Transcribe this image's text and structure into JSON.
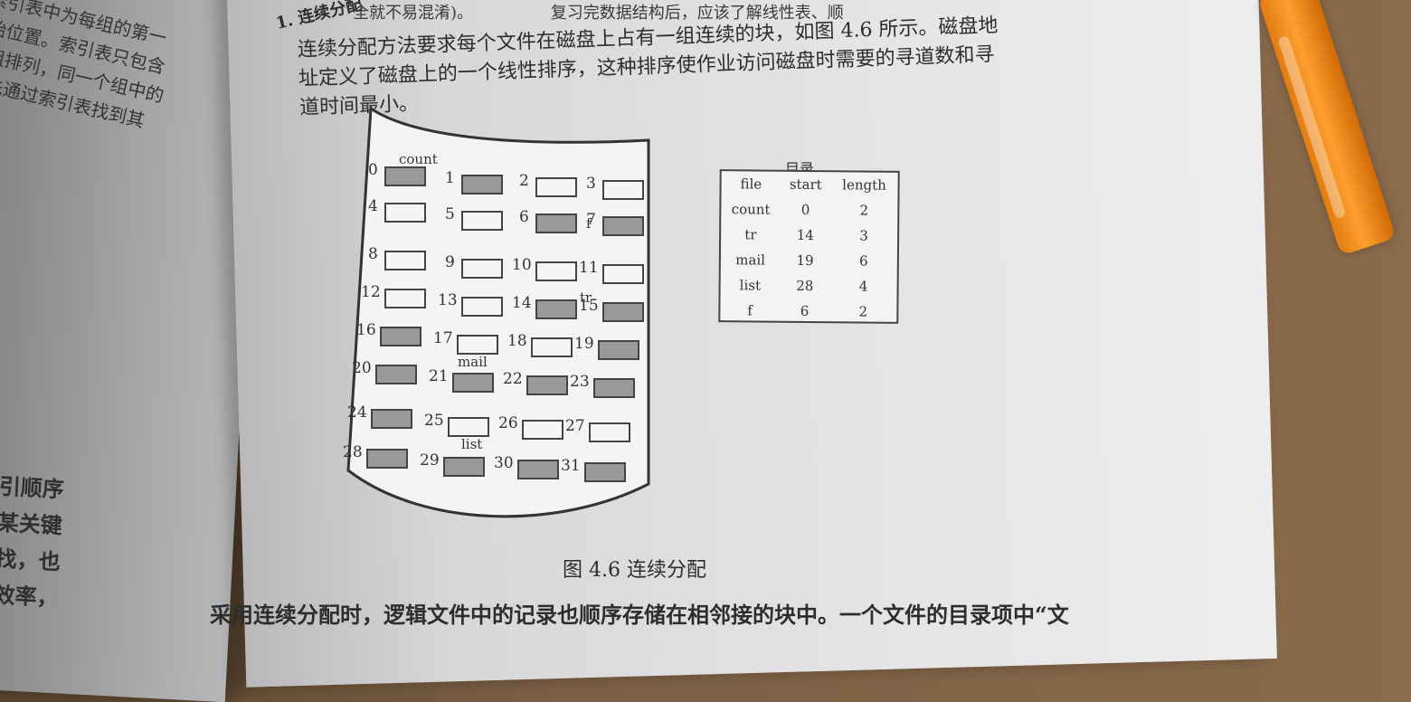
{
  "left_page": {
    "lines": [
      "索引表中为每组的第一",
      "始位置。索引表只包含",
      "组排列，同一个组中的",
      "先通过索引表找到其"
    ],
    "bottom_lines": [
      "在索引顺序",
      "查找某关键",
      "序查找，也",
      "查找效率，"
    ]
  },
  "right_page": {
    "top_text": "全就不易混淆)。",
    "top_text_right": "复习完数据结构后，应该了解线性表、顺",
    "section_title": "1. 连续分配",
    "paragraph": "连续分配方法要求每个文件在磁盘上占有一组连续的块，如图 4.6 所示。磁盘地址定义了磁盘上的一个线性排序，这种排序使作业访问磁盘时需要的寻道数和寻道时间最小。",
    "figure_caption": "图 4.6   连续分配",
    "bottom_text": "采用连续分配时，逻辑文件中的记录也顺序存储在相邻接的块中。一个文件的目录项中“文"
  },
  "figure": {
    "file_labels": [
      "count",
      "f",
      "tr",
      "mail",
      "list"
    ],
    "blocks": [
      {
        "n": "0",
        "fill": true
      },
      {
        "n": "1",
        "fill": true
      },
      {
        "n": "2",
        "fill": false
      },
      {
        "n": "3",
        "fill": false
      },
      {
        "n": "4",
        "fill": false
      },
      {
        "n": "5",
        "fill": false
      },
      {
        "n": "6",
        "fill": true
      },
      {
        "n": "7",
        "fill": true
      },
      {
        "n": "8",
        "fill": false
      },
      {
        "n": "9",
        "fill": false
      },
      {
        "n": "10",
        "fill": false
      },
      {
        "n": "11",
        "fill": false
      },
      {
        "n": "12",
        "fill": false
      },
      {
        "n": "13",
        "fill": false
      },
      {
        "n": "14",
        "fill": true
      },
      {
        "n": "15",
        "fill": true
      },
      {
        "n": "16",
        "fill": true
      },
      {
        "n": "17",
        "fill": false
      },
      {
        "n": "18",
        "fill": false
      },
      {
        "n": "19",
        "fill": true
      },
      {
        "n": "20",
        "fill": true
      },
      {
        "n": "21",
        "fill": true
      },
      {
        "n": "22",
        "fill": true
      },
      {
        "n": "23",
        "fill": true
      },
      {
        "n": "24",
        "fill": true
      },
      {
        "n": "25",
        "fill": false
      },
      {
        "n": "26",
        "fill": false
      },
      {
        "n": "27",
        "fill": false
      },
      {
        "n": "28",
        "fill": true
      },
      {
        "n": "29",
        "fill": true
      },
      {
        "n": "30",
        "fill": true
      },
      {
        "n": "31",
        "fill": true
      }
    ]
  },
  "directory": {
    "title": "目录",
    "headers": [
      "file",
      "start",
      "length"
    ],
    "rows": [
      [
        "count",
        "0",
        "2"
      ],
      [
        "tr",
        "14",
        "3"
      ],
      [
        "mail",
        "19",
        "6"
      ],
      [
        "list",
        "28",
        "4"
      ],
      [
        "f",
        "6",
        "2"
      ]
    ]
  },
  "colors": {
    "pen": "#ff9f2f",
    "desk": "#7b6044",
    "paper": "#e4e4e6",
    "block_fill": "#999999"
  }
}
